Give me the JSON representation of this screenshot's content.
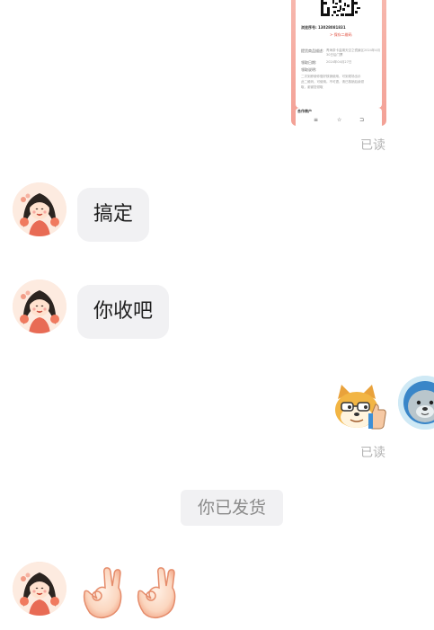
{
  "card": {
    "phone_line": "浏览序号: 13028081831",
    "red_link": "> 保存二维码",
    "line_a_label": "提货商品描述:",
    "line_a_value": "青海茶卡盐湖天空之镜景区2024年4月",
    "line_a_value2": "30日后门票",
    "line_b_label": "领取日期:",
    "line_b_value": "2024年04月27日",
    "line_c_label": "领取说明:",
    "note1": "二次到即使你做好核销使用，可到现场出示",
    "note2": "此二维码，可使用。不可退，请已核销后续领",
    "note3": "取，谢谢您领取",
    "footer_label": "合作商户",
    "footer_icons": [
      "list-icon",
      "star-icon",
      "box-icon"
    ]
  },
  "read_status_1": "已读",
  "messages": [
    {
      "text": "搞定"
    },
    {
      "text": "你收吧"
    }
  ],
  "read_status_2": "已读",
  "system_notice": "你已发货"
}
